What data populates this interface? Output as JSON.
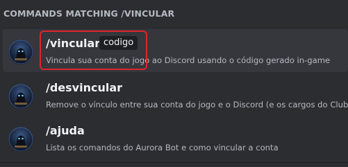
{
  "header": {
    "title": "COMMANDS MATCHING /VINCULAR"
  },
  "commands": [
    {
      "name": "/vincular",
      "param": "codigo",
      "description": "Vincula sua conta do jogo ao Discord usando o código gerado in-game",
      "avatar_icon": "aurora-bot-avatar-icon",
      "selected": true
    },
    {
      "name": "/desvincular",
      "description": "Remove o vínculo entre sua conta do jogo e o Discord (e os cargos do Clube)",
      "avatar_icon": "aurora-bot-avatar-icon"
    },
    {
      "name": "/ajuda",
      "description": "Lista os comandos do Aurora Bot e como vincular a conta",
      "avatar_icon": "aurora-bot-avatar-icon"
    }
  ],
  "colors": {
    "background": "#2b2d31",
    "selected_row": "#35373c",
    "highlight_border": "#e0242f",
    "text_primary": "#f2f3f5",
    "text_muted": "#b5bac1"
  }
}
